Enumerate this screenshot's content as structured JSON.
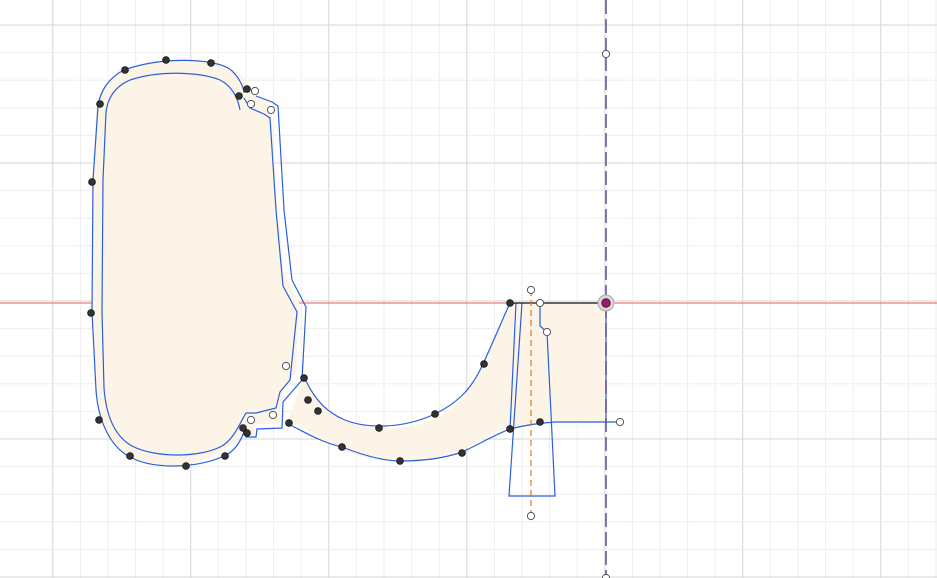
{
  "app": {
    "view": "sketch-canvas",
    "tool_state": "sketch-edit"
  },
  "colors": {
    "background": "#ffffff",
    "grid_minor": "#eeeeee",
    "grid_major": "#d6d6d6",
    "axis_horizontal": "#e06060",
    "construction_vertical": "#5a4a96",
    "profile_fill": "#fdf4e8",
    "profile_stroke": "#2b5fd9",
    "point_fill": "#333333",
    "point_open_stroke": "#555555",
    "origin_point": "#9c1a6e",
    "center_line": "#e07a20",
    "closing_line": "#111111"
  },
  "icons": {
    "sketch_point": "dot",
    "construction_point": "hollow-circle",
    "origin": "origin-point"
  }
}
